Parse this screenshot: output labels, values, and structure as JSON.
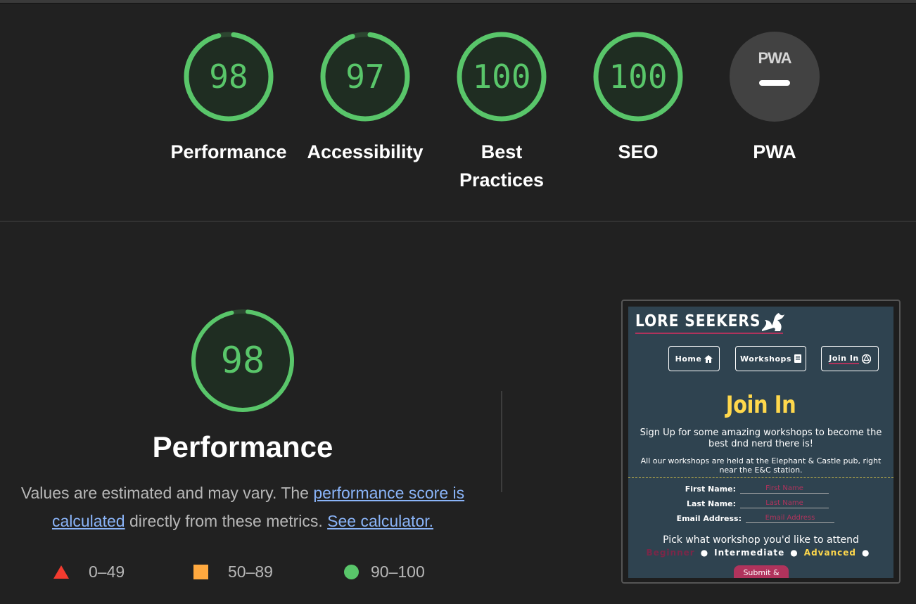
{
  "categories": [
    {
      "score": "98",
      "label": "Performance",
      "fraction": 0.98
    },
    {
      "score": "97",
      "label": "Accessibility",
      "fraction": 0.97
    },
    {
      "score": "100",
      "label": "Best Practices",
      "fraction": 1.0
    },
    {
      "score": "100",
      "label": "SEO",
      "fraction": 1.0
    },
    {
      "score": "PWA",
      "label": "PWA",
      "fraction": 0
    }
  ],
  "performance": {
    "score": "98",
    "fraction": 0.98,
    "title": "Performance",
    "desc_prefix": "Values are estimated and may vary. The ",
    "desc_link": "performance score is calculated",
    "desc_mid": " directly from these metrics. ",
    "calc_link": "See calculator."
  },
  "legend": {
    "fail": "0–49",
    "average": "50–89",
    "pass": "90–100"
  },
  "colors": {
    "pass": "#59c66a",
    "average": "#ffa93f",
    "fail": "#f33b2f",
    "link": "#8ab4f8"
  },
  "thumbnail": {
    "brand": "LORE SEEKERS",
    "nav": [
      "Home",
      "Workshops",
      "Join In"
    ],
    "heading": "Join In",
    "intro": "Sign Up for some amazing workshops to become the best dnd nerd there is!",
    "note": "All our workshops are held at the Elephant & Castle pub, right near the E&C station.",
    "fields": [
      {
        "label": "First Name:",
        "placeholder": "First Name"
      },
      {
        "label": "Last Name:",
        "placeholder": "Last Name"
      },
      {
        "label": "Email Address:",
        "placeholder": "Email Address"
      }
    ],
    "pick": "Pick what workshop you'd like to attend",
    "levels": [
      "Beginner",
      "Intermediate",
      "Advanced"
    ],
    "submit": "Submit &"
  }
}
